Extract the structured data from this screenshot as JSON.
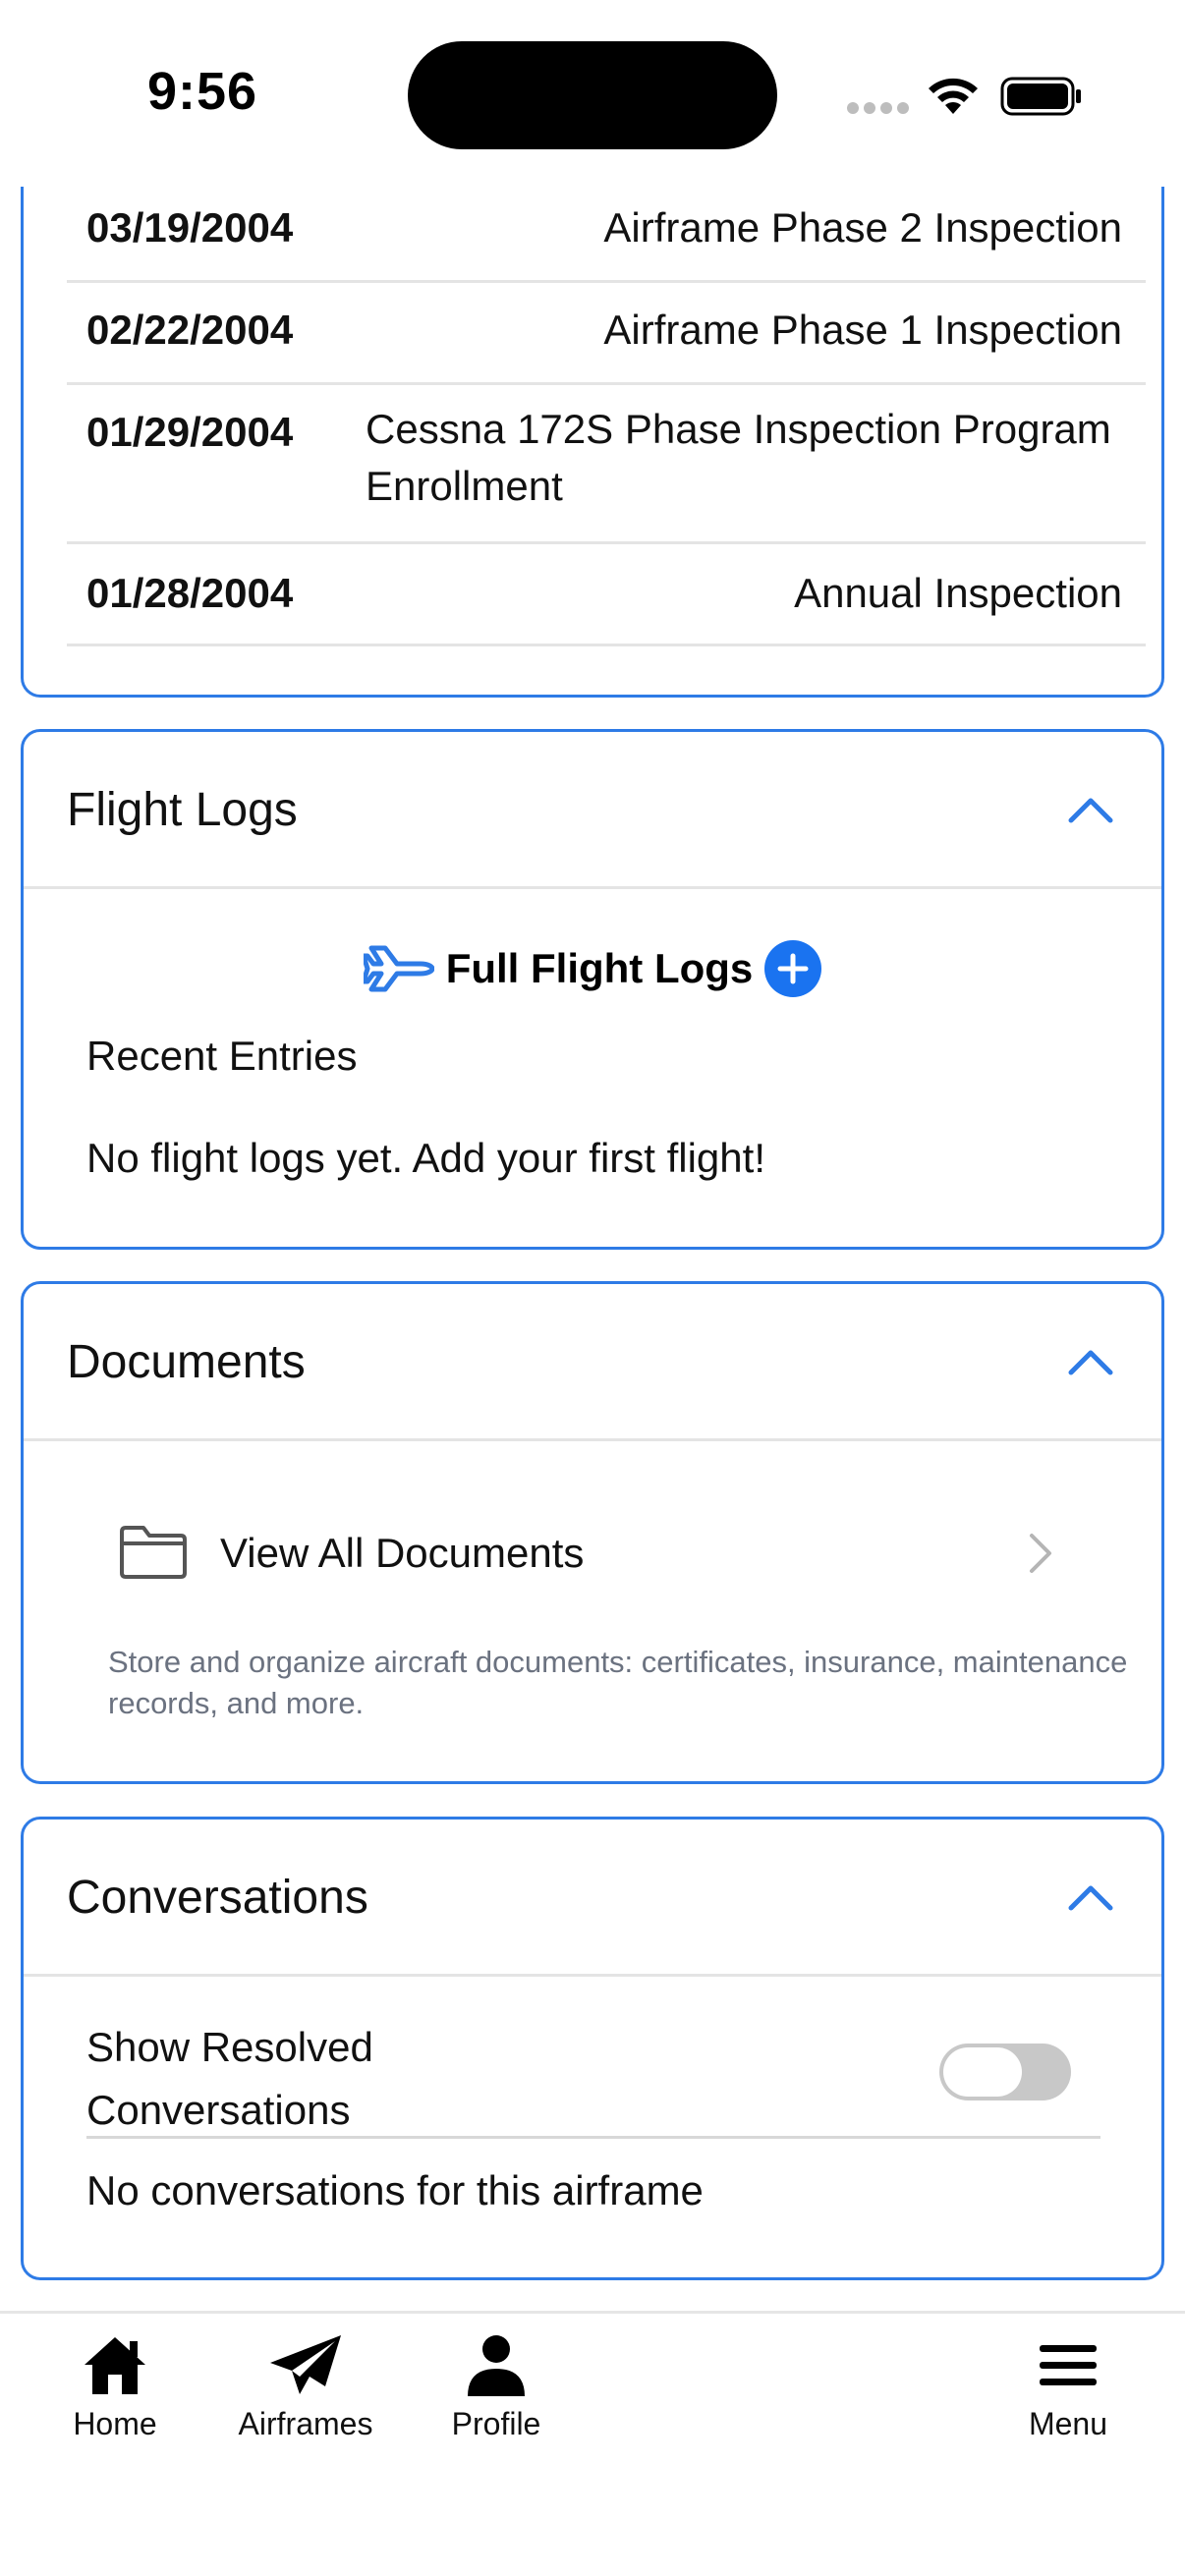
{
  "status_bar": {
    "time": "9:56"
  },
  "inspections": {
    "rows": [
      {
        "date": "03/19/2004",
        "description": "Airframe Phase 2 Inspection"
      },
      {
        "date": "02/22/2004",
        "description": "Airframe Phase 1 Inspection"
      },
      {
        "date": "01/29/2004",
        "description": "Cessna 172S Phase Inspection Program Enrollment"
      },
      {
        "date": "01/28/2004",
        "description": "Annual Inspection"
      }
    ]
  },
  "flight_logs": {
    "title": "Flight Logs",
    "full_logs_label": "Full Flight Logs",
    "recent_label": "Recent Entries",
    "empty_message": "No flight logs yet. Add your first flight!"
  },
  "documents": {
    "title": "Documents",
    "view_all_label": "View All Documents",
    "description": "Store and organize aircraft documents: certificates, insurance, maintenance records, and more."
  },
  "conversations": {
    "title": "Conversations",
    "show_resolved_label": "Show Resolved Conversations",
    "show_resolved_value": false,
    "empty_message": "No conversations for this airframe"
  },
  "tab_bar": {
    "home": "Home",
    "airframes": "Airframes",
    "profile": "Profile",
    "menu": "Menu"
  },
  "colors": {
    "accent": "#2e7be6",
    "border": "#e4e4e4",
    "muted_text": "#6b7280"
  }
}
